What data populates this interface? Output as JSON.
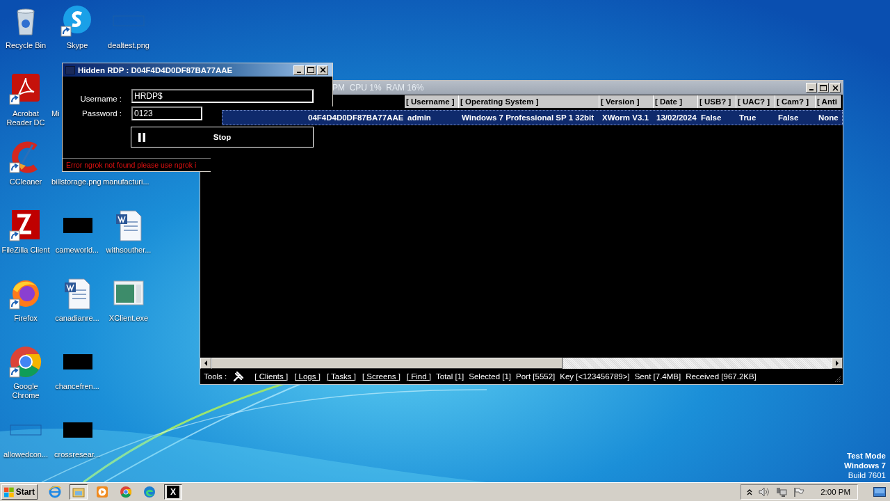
{
  "desktop": {
    "icon_rows": [
      [
        {
          "label": "Recycle Bin",
          "kind": "recycle",
          "shortcut": false
        },
        {
          "label": "Skype",
          "kind": "skype",
          "shortcut": true
        },
        {
          "label": "dealtest.png",
          "kind": "thumb-blank",
          "shortcut": false
        }
      ],
      [
        {
          "label": "Acrobat Reader DC",
          "kind": "acrobat",
          "shortcut": true
        },
        {
          "label": "Mi",
          "kind": "covered",
          "shortcut": false
        }
      ],
      [
        {
          "label": "CCleaner",
          "kind": "ccleaner",
          "shortcut": true
        },
        {
          "label": "billstorage.png",
          "kind": "covered",
          "shortcut": false
        },
        {
          "label": "manufacturi...",
          "kind": "covered",
          "shortcut": false
        }
      ],
      [
        {
          "label": "FileZilla Client",
          "kind": "filezilla",
          "shortcut": true
        },
        {
          "label": "cameworld...",
          "kind": "thumb-black",
          "shortcut": false
        },
        {
          "label": "withsouther...",
          "kind": "word",
          "shortcut": false
        }
      ],
      [
        {
          "label": "Firefox",
          "kind": "firefox",
          "shortcut": true
        },
        {
          "label": "canadianre...",
          "kind": "word",
          "shortcut": false
        },
        {
          "label": "XClient.exe",
          "kind": "exe",
          "shortcut": false
        }
      ],
      [
        {
          "label": "Google Chrome",
          "kind": "chrome",
          "shortcut": true
        },
        {
          "label": "chancefren...",
          "kind": "thumb-black",
          "shortcut": false
        }
      ],
      [
        {
          "label": "allowedcon...",
          "kind": "thumb-blank",
          "shortcut": false
        },
        {
          "label": "crossresear...",
          "kind": "thumb-black",
          "shortcut": false
        }
      ]
    ]
  },
  "rdp_window": {
    "title": "Hidden RDP : D04F4D4D0DF87BA77AAE",
    "username_label": "Username :",
    "username": "HRDP$",
    "password_label": "Password :",
    "password": "0123",
    "stop_button": "Stop",
    "error": "Error ngrok not found please use ngrok i"
  },
  "main_window": {
    "title": "PM  CPU 1%  RAM 16%",
    "columns": [
      "",
      "[ Username ]",
      "[ Operating System ]",
      "[ Version ]",
      "[ Date ]",
      "[ USB? ]",
      "[ UAC? ]",
      "[ Cam? ]",
      "[ Anti"
    ],
    "rows": [
      {
        "selected": true,
        "cells": [
          "04F4D4D0DF87BA77AAE",
          "admin",
          "Windows 7 Professional SP 1 32bit",
          "XWorm V3.1",
          "13/02/2024",
          "False",
          "True",
          "False",
          "None"
        ]
      }
    ],
    "tools_label": "Tools :",
    "tool_links": [
      "[ Clients ]",
      "[ Logs ]",
      "[ Tasks ]",
      "[ Screens ]",
      "[ Find ]"
    ],
    "stats": [
      "Total [1]",
      "Selected [1]",
      "Port [5552]",
      "Key [<123456789>]",
      "Sent [7.4MB]",
      "Received [967.2KB]"
    ]
  },
  "system_notice": [
    "Test Mode",
    "Windows 7",
    "Build 7601"
  ],
  "taskbar": {
    "start": "Start",
    "apps": [
      {
        "kind": "ie",
        "selected": false
      },
      {
        "kind": "explorer",
        "selected": true
      },
      {
        "kind": "media",
        "selected": false
      },
      {
        "kind": "chrome",
        "selected": false
      },
      {
        "kind": "edge",
        "selected": false
      },
      {
        "kind": "xworm",
        "label": "X",
        "selected": true
      }
    ],
    "clock": "2:00 PM"
  }
}
